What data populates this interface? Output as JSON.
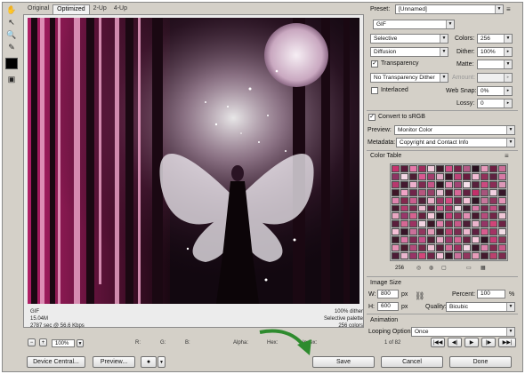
{
  "tabs": [
    {
      "label": "Original"
    },
    {
      "label": "Optimized"
    },
    {
      "label": "2-Up"
    },
    {
      "label": "4-Up"
    }
  ],
  "image_info": {
    "left_line1": "GIF",
    "left_line2": "15.04M",
    "left_line3": "2787 sec @ 56.6 Kbps",
    "right_line1": "100% dither",
    "right_line2": "Selective palette",
    "right_line3": "256 colors"
  },
  "status": {
    "zoom": "100%",
    "r": "R:",
    "g": "G:",
    "b": "B:",
    "alpha": "Alpha:",
    "hex": "Hex:",
    "index": "Index:",
    "frame": "1 of 82"
  },
  "buttons": {
    "device_central": "Device Central...",
    "preview": "Preview...",
    "save": "Save",
    "cancel": "Cancel",
    "done": "Done"
  },
  "settings": {
    "preset_label": "Preset:",
    "preset_value": "[Unnamed]",
    "format": "GIF",
    "reduction": "Selective",
    "colors_label": "Colors:",
    "colors": "256",
    "dither_algo": "Diffusion",
    "dither_label": "Dither:",
    "dither": "100%",
    "transparency": "Transparency",
    "matte_label": "Matte:",
    "transparency_dither": "No Transparency Dither",
    "amount_label": "Amount:",
    "interlaced": "Interlaced",
    "web_snap_label": "Web Snap:",
    "web_snap": "0%",
    "lossy_label": "Lossy:",
    "lossy": "0",
    "convert_srgb": "Convert to sRGB",
    "preview_label": "Preview:",
    "preview_value": "Monitor Color",
    "metadata_label": "Metadata:",
    "metadata_value": "Copyright and Contact Info"
  },
  "color_table": {
    "title": "Color Table",
    "count": "256",
    "swatches": [
      "#c8326e",
      "#5a1a3a",
      "#e678aa",
      "#9e2a5c",
      "#f0c8da",
      "#3a1828",
      "#d24c86",
      "#7a2048",
      "#b45a86",
      "#2a1020",
      "#e89abc",
      "#6e1e42",
      "#cc6e98",
      "#8c3462",
      "#f4d8e6",
      "#4c1e34",
      "#d85a92",
      "#a03c6c",
      "#e0a8c4",
      "#341424",
      "#be4478",
      "#681c3e",
      "#f2bcd4",
      "#92305a",
      "#5e2240",
      "#d87aa6",
      "#b8386e",
      "#441a30",
      "#ecb0cc",
      "#7e2a50",
      "#c65488",
      "#2e1220",
      "#e48cb4",
      "#a24474",
      "#f6e2ec",
      "#58203c",
      "#cc4a80",
      "#8a2c56",
      "#dc98b8",
      "#3e1628",
      "#f0a4c6",
      "#70244a",
      "#b6567e",
      "#964068",
      "#e8c0d4",
      "#4a1a30",
      "#d86696",
      "#622040",
      "#c2306a",
      "#a6547c",
      "#f2d0e0",
      "#38162a",
      "#de84ae",
      "#84284e",
      "#ca5e8e",
      "#502038",
      "#eaaec8",
      "#9a3664",
      "#d44880",
      "#6a2446",
      "#f4c4d8",
      "#321424",
      "#c8769c",
      "#8e345c",
      "#e694b8",
      "#46182e",
      "#b43a6e",
      "#782a4c",
      "#ecbcd0",
      "#5c1c3c",
      "#d25a8c",
      "#a02e60",
      "#f0dae4",
      "#3c1a2c",
      "#dc7aa8",
      "#7c2850",
      "#c44e82",
      "#54203a",
      "#e8a6c2",
      "#98386a",
      "#d66290",
      "#66203e",
      "#f6cadc",
      "#2c1220",
      "#c23c74",
      "#8a3058",
      "#e28eb2",
      "#48182e",
      "#b64c7c",
      "#722648",
      "#eec6d6",
      "#5a1e3c",
      "#d46894",
      "#9c3262",
      "#f2d4e2",
      "#3a1626",
      "#de80aa",
      "#80284c",
      "#c85888",
      "#4e1e36",
      "#eab4cc",
      "#943466",
      "#d04478",
      "#6c2244",
      "#f4c0d6",
      "#361428",
      "#ca709a",
      "#90365e",
      "#e49ab8",
      "#421a2c",
      "#b8406e",
      "#7a2a4e",
      "#ecb8ce",
      "#5e2040",
      "#d85c8e",
      "#a23464",
      "#f0dce6",
      "#3e182a",
      "#da78a6",
      "#7e2a52",
      "#c6508a",
      "#522036",
      "#e8aac6",
      "#9a3868",
      "#d46492",
      "#6a2242",
      "#f6c8da",
      "#301222",
      "#c63e76",
      "#8c3258",
      "#e490b4",
      "#4a1a2e",
      "#b24a7a",
      "#762848",
      "#eec2d4",
      "#581e3a",
      "#d26a96",
      "#9e3060",
      "#f2d6e4",
      "#381628",
      "#dc82ac",
      "#82284e",
      "#ca5a8a",
      "#4c1c36",
      "#eab6ce",
      "#963466",
      "#d2467a",
      "#6e2446",
      "#f4c2d8",
      "#341424",
      "#cc729c",
      "#92365e",
      "#e69cba",
      "#441a2e",
      "#ba426e",
      "#7c2a4e",
      "#ecbad0",
      "#601e40",
      "#da5e90",
      "#a43666",
      "#f0dee8",
      "#3c182c",
      "#d87ca8",
      "#7e2a50",
      "#c4528a",
      "#502036",
      "#e8acc8",
      "#9c3a68",
      "#d66694",
      "#682242",
      "#f6cadc",
      "#2e1222",
      "#c44078",
      "#8e325a",
      "#e292b6",
      "#481a2e",
      "#b44c7c",
      "#742848",
      "#eec4d6",
      "#5a1e3c",
      "#d46c96",
      "#a03262",
      "#f2d8e6",
      "#361628",
      "#de84ac",
      "#84284e",
      "#c85c8a",
      "#4e1c36",
      "#eab8ce",
      "#983666",
      "#d4487c",
      "#702446",
      "#f4c4d8",
      "#321424",
      "#ca749e",
      "#94385e",
      "#e49ebc",
      "#461a2e",
      "#b8446e",
      "#7e2a4e",
      "#ecbcd0",
      "#5e1e40",
      "#d86090",
      "#a63866",
      "#f0e0e8",
      "#3a182a",
      "#da7ea8",
      "#802a52",
      "#c6548a",
      "#542038",
      "#e8aec8",
      "#9e3a6a",
      "#d46894",
      "#6a2244",
      "#f6ccdc",
      "#2c1220",
      "#c24278",
      "#90345a",
      "#e294b6",
      "#4a1a30",
      "#b24e7c",
      "#782a4a",
      "#eec6d8",
      "#5c1e3c",
      "#d26e98",
      "#a23462",
      "#f2dae6",
      "#381628",
      "#dc86ae",
      "#862a50",
      "#ca5e8c",
      "#501c38",
      "#eabad0",
      "#9a3868",
      "#d24a7c",
      "#722646",
      "#f4c6da",
      "#341424",
      "#cc76a0",
      "#963a60",
      "#e6a0be",
      "#441a30"
    ]
  },
  "image_size": {
    "title": "Image Size",
    "w_label": "W:",
    "w": "800",
    "h_label": "H:",
    "h": "600",
    "unit": "px",
    "percent_label": "Percent:",
    "percent": "100",
    "percent_unit": "%",
    "quality_label": "Quality:",
    "quality": "Bicubic"
  },
  "animation": {
    "title": "Animation",
    "looping_label": "Looping Options:",
    "looping": "Once"
  },
  "colors": {
    "accent_arrow": "#2e8b2e",
    "window_bg": "#d4d0c8"
  }
}
